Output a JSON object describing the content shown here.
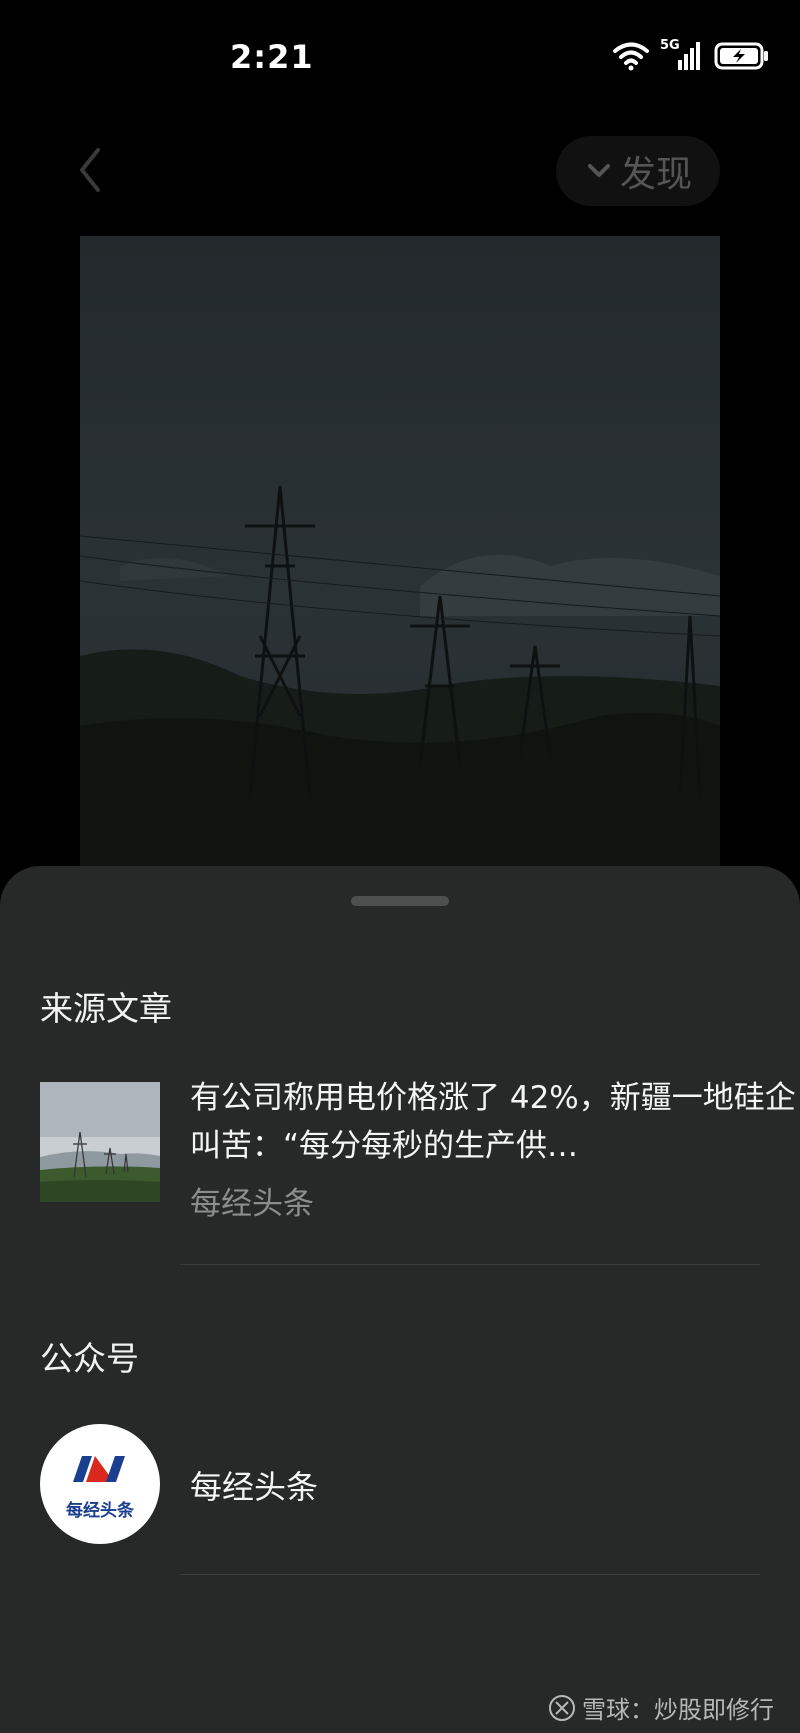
{
  "status_bar": {
    "time": "2:21",
    "network": "5G",
    "icons": [
      "wifi-icon",
      "signal-icon",
      "battery-charging-icon"
    ]
  },
  "nav": {
    "back_icon": "chevron-left-icon",
    "discover_label": "发现",
    "discover_icon": "chevron-down-icon"
  },
  "photo": {
    "description_icon": "power-tower-landscape-image"
  },
  "sheet": {
    "source_section_title": "来源文章",
    "article": {
      "title": "有公司称用电价格涨了 42%，新疆一地硅企叫苦：“每分每秒的生产供…",
      "source": "每经头条"
    },
    "account_section_title": "公众号",
    "account": {
      "name": "每经头条",
      "logo_text": "每经头条"
    }
  },
  "watermark": {
    "text": "雪球：炒股即修行"
  },
  "colors": {
    "background": "#000000",
    "sheet": "#262928",
    "secondary_text": "#8b8e8d",
    "logo_blue": "#1b3f8f",
    "logo_red": "#d9281e"
  }
}
